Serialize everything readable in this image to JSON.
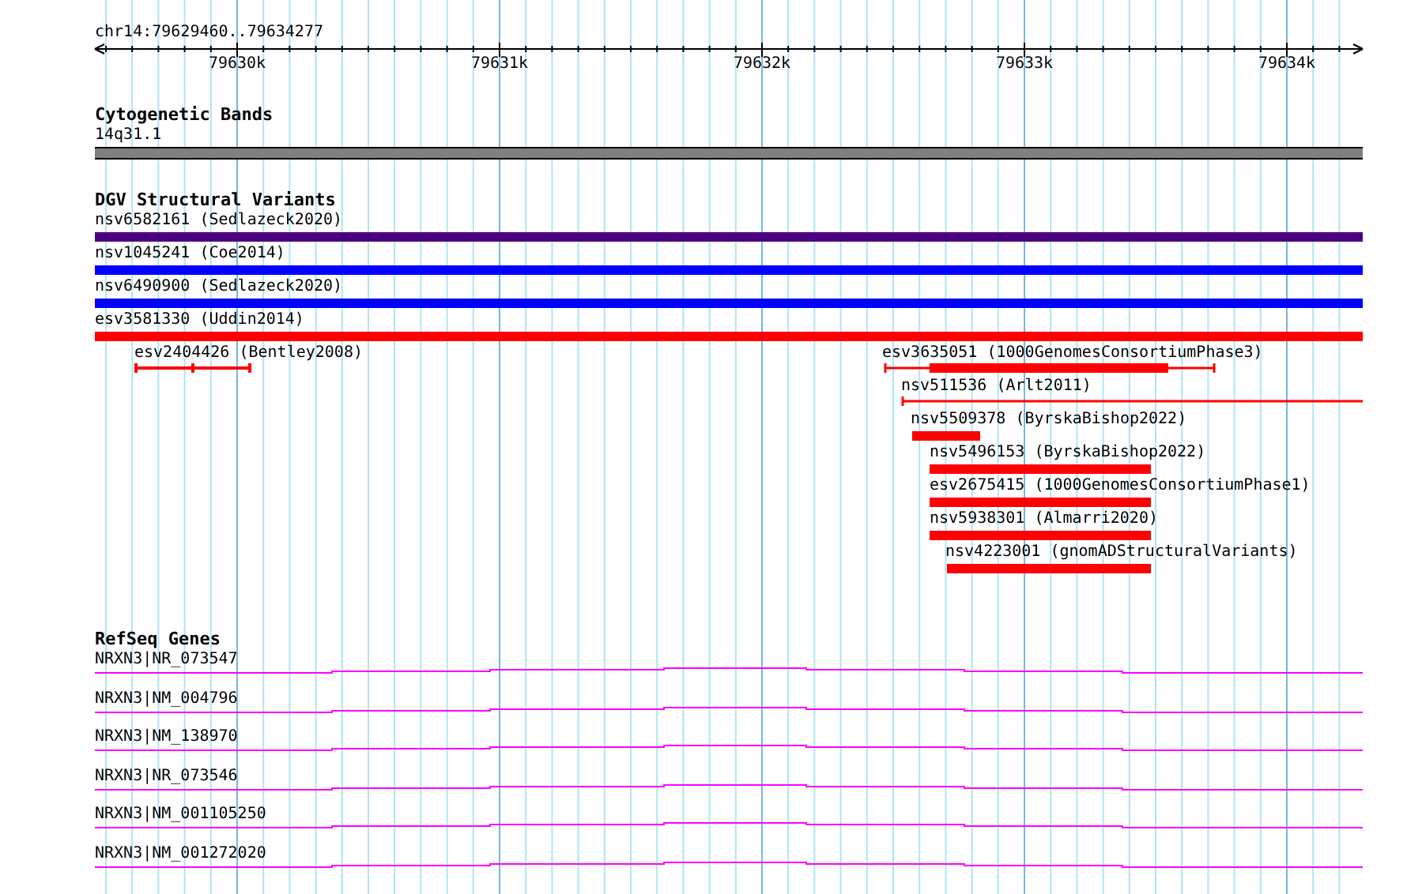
{
  "ruler": {
    "location": "chr14:79629460..79634277",
    "tick_labels": [
      "79630k",
      "79631k",
      "79632k",
      "79633k",
      "79634k"
    ]
  },
  "cytogenetic_track": {
    "title": "Cytogenetic Bands",
    "bands": [
      {
        "label": "14q31.1"
      }
    ]
  },
  "dgv_track": {
    "title": "DGV Structural Variants",
    "features": [
      {
        "label": "nsv6582161 (Sedlazeck2020)",
        "kind": "bar",
        "color": "#4b0082"
      },
      {
        "label": "nsv1045241 (Coe2014)",
        "kind": "bar",
        "color": "#0000ff"
      },
      {
        "label": "nsv6490900 (Sedlazeck2020)",
        "kind": "bar",
        "color": "#0000ff"
      },
      {
        "label": "esv3581330 (Uddin2014)",
        "kind": "bar",
        "color": "#ff0000"
      },
      {
        "label": "esv2404426 (Bentley2008)",
        "kind": "segmented",
        "color": "#ff0000"
      },
      {
        "label": "esv3635051 (1000GenomesConsortiumPhase3)",
        "kind": "interval",
        "color": "#ff0000"
      },
      {
        "label": "nsv511536 (Arlt2011)",
        "kind": "span",
        "color": "#ff0000"
      },
      {
        "label": "nsv5509378 (ByrskaBishop2022)",
        "kind": "bar",
        "color": "#ff0000"
      },
      {
        "label": "nsv5496153 (ByrskaBishop2022)",
        "kind": "bar",
        "color": "#ff0000"
      },
      {
        "label": "esv2675415 (1000GenomesConsortiumPhase1)",
        "kind": "bar",
        "color": "#ff0000"
      },
      {
        "label": "nsv5938301 (Almarri2020)",
        "kind": "bar",
        "color": "#ff0000"
      },
      {
        "label": "nsv4223001 (gnomADStructuralVariants)",
        "kind": "bar",
        "color": "#ff0000"
      }
    ]
  },
  "refseq_track": {
    "title": "RefSeq Genes",
    "genes": [
      {
        "label": "NRXN3|NR_073547"
      },
      {
        "label": "NRXN3|NM_004796"
      },
      {
        "label": "NRXN3|NM_138970"
      },
      {
        "label": "NRXN3|NR_073546"
      },
      {
        "label": "NRXN3|NM_001105250"
      },
      {
        "label": "NRXN3|NM_001272020"
      }
    ]
  }
}
